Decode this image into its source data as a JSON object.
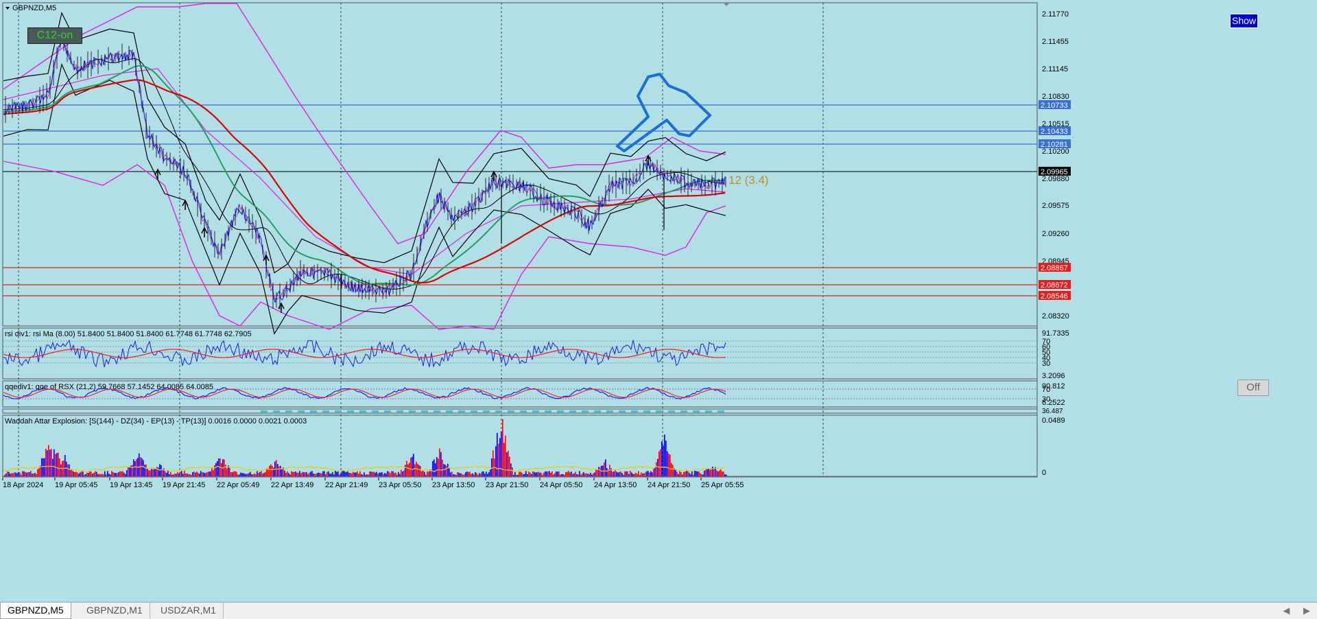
{
  "window": {
    "symbol_title": "GBPNZD,M5"
  },
  "buttons": {
    "show": "Show",
    "off": "Off",
    "c12": "C12-on"
  },
  "main_chart": {
    "price_axis_labels": [
      "2.11770",
      "2.11455",
      "2.11145",
      "2.10830",
      "2.10515",
      "2.10200",
      "2.09880",
      "2.09575",
      "2.09260",
      "2.08945",
      "2.08320"
    ],
    "level_labels": [
      {
        "text": "2.10733",
        "color": "#3a6fd8"
      },
      {
        "text": "2.10433",
        "color": "#3a6fd8"
      },
      {
        "text": "2.10281",
        "color": "#3a6fd8"
      },
      {
        "text": "2.09965",
        "color": "#000000"
      },
      {
        "text": "2.08867",
        "color": "#e02020"
      },
      {
        "text": "2.08672",
        "color": "#e02020"
      },
      {
        "text": "2.08546",
        "color": "#e02020"
      }
    ],
    "annotation": "12 (3.4)"
  },
  "time_labels": [
    "18 Apr 2024",
    "19 Apr 05:45",
    "19 Apr 13:45",
    "19 Apr 21:45",
    "22 Apr 05:49",
    "22 Apr 13:49",
    "22 Apr 21:49",
    "23 Apr 05:50",
    "23 Apr 13:50",
    "23 Apr 21:50",
    "24 Apr 05:50",
    "24 Apr 13:50",
    "24 Apr 21:50",
    "25 Apr 05:55"
  ],
  "rsi_panel": {
    "title": "rsi div1: rsi Ma (8.00) 51.8400 51.8400 51.8400 61.7748 61.7748 62.7905",
    "axis": [
      "91.7335",
      "70",
      "60",
      "50",
      "40",
      "30",
      "3.2096"
    ]
  },
  "qqe_panel": {
    "title": "qqediv1: qqe of RSX (21,2) 59.7668 57.1452 64.0085 64.0085",
    "axis": [
      "90.812",
      "70",
      "30",
      "6.2522"
    ]
  },
  "thin_panel": {
    "axis": "36.487"
  },
  "waddah_panel": {
    "title": "Waddah Attar Explosion: [S(144) - DZ(34) - EP(13) - TP(13)] 0.0016 0.0000 0.0021 0.0003",
    "axis": [
      "0.0489",
      "0"
    ]
  },
  "tabs": [
    "GBPNZD,M5",
    "GBPNZD,M1",
    "USDZAR,M1"
  ],
  "scroll": {
    "left": "◀",
    "right": "▶"
  },
  "colors": {
    "background": "#b0dfe5",
    "blue_lines": "#3a6fd8",
    "red_lines": "#e02020",
    "bollinger": "#000000",
    "envelope": "#e81ee8",
    "ma_red": "#e00000",
    "ma_green": "#20a060",
    "rsi_blue": "#1a1aff",
    "rsi_red": "#ff2020",
    "waddah_blue": "#0000ff",
    "waddah_red": "#ff0000",
    "waddah_yellow": "#e8d000"
  }
}
